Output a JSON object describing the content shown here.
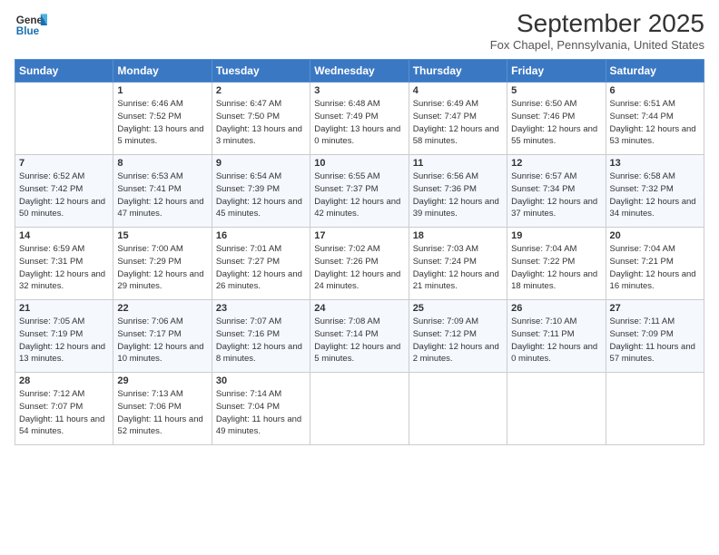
{
  "header": {
    "logo_line1": "General",
    "logo_line2": "Blue",
    "title": "September 2025",
    "subtitle": "Fox Chapel, Pennsylvania, United States"
  },
  "columns": [
    "Sunday",
    "Monday",
    "Tuesday",
    "Wednesday",
    "Thursday",
    "Friday",
    "Saturday"
  ],
  "weeks": [
    [
      {
        "day": "",
        "sunrise": "",
        "sunset": "",
        "daylight": ""
      },
      {
        "day": "1",
        "sunrise": "6:46 AM",
        "sunset": "7:52 PM",
        "daylight": "13 hours and 5 minutes."
      },
      {
        "day": "2",
        "sunrise": "6:47 AM",
        "sunset": "7:50 PM",
        "daylight": "13 hours and 3 minutes."
      },
      {
        "day": "3",
        "sunrise": "6:48 AM",
        "sunset": "7:49 PM",
        "daylight": "13 hours and 0 minutes."
      },
      {
        "day": "4",
        "sunrise": "6:49 AM",
        "sunset": "7:47 PM",
        "daylight": "12 hours and 58 minutes."
      },
      {
        "day": "5",
        "sunrise": "6:50 AM",
        "sunset": "7:46 PM",
        "daylight": "12 hours and 55 minutes."
      },
      {
        "day": "6",
        "sunrise": "6:51 AM",
        "sunset": "7:44 PM",
        "daylight": "12 hours and 53 minutes."
      }
    ],
    [
      {
        "day": "7",
        "sunrise": "6:52 AM",
        "sunset": "7:42 PM",
        "daylight": "12 hours and 50 minutes."
      },
      {
        "day": "8",
        "sunrise": "6:53 AM",
        "sunset": "7:41 PM",
        "daylight": "12 hours and 47 minutes."
      },
      {
        "day": "9",
        "sunrise": "6:54 AM",
        "sunset": "7:39 PM",
        "daylight": "12 hours and 45 minutes."
      },
      {
        "day": "10",
        "sunrise": "6:55 AM",
        "sunset": "7:37 PM",
        "daylight": "12 hours and 42 minutes."
      },
      {
        "day": "11",
        "sunrise": "6:56 AM",
        "sunset": "7:36 PM",
        "daylight": "12 hours and 39 minutes."
      },
      {
        "day": "12",
        "sunrise": "6:57 AM",
        "sunset": "7:34 PM",
        "daylight": "12 hours and 37 minutes."
      },
      {
        "day": "13",
        "sunrise": "6:58 AM",
        "sunset": "7:32 PM",
        "daylight": "12 hours and 34 minutes."
      }
    ],
    [
      {
        "day": "14",
        "sunrise": "6:59 AM",
        "sunset": "7:31 PM",
        "daylight": "12 hours and 32 minutes."
      },
      {
        "day": "15",
        "sunrise": "7:00 AM",
        "sunset": "7:29 PM",
        "daylight": "12 hours and 29 minutes."
      },
      {
        "day": "16",
        "sunrise": "7:01 AM",
        "sunset": "7:27 PM",
        "daylight": "12 hours and 26 minutes."
      },
      {
        "day": "17",
        "sunrise": "7:02 AM",
        "sunset": "7:26 PM",
        "daylight": "12 hours and 24 minutes."
      },
      {
        "day": "18",
        "sunrise": "7:03 AM",
        "sunset": "7:24 PM",
        "daylight": "12 hours and 21 minutes."
      },
      {
        "day": "19",
        "sunrise": "7:04 AM",
        "sunset": "7:22 PM",
        "daylight": "12 hours and 18 minutes."
      },
      {
        "day": "20",
        "sunrise": "7:04 AM",
        "sunset": "7:21 PM",
        "daylight": "12 hours and 16 minutes."
      }
    ],
    [
      {
        "day": "21",
        "sunrise": "7:05 AM",
        "sunset": "7:19 PM",
        "daylight": "12 hours and 13 minutes."
      },
      {
        "day": "22",
        "sunrise": "7:06 AM",
        "sunset": "7:17 PM",
        "daylight": "12 hours and 10 minutes."
      },
      {
        "day": "23",
        "sunrise": "7:07 AM",
        "sunset": "7:16 PM",
        "daylight": "12 hours and 8 minutes."
      },
      {
        "day": "24",
        "sunrise": "7:08 AM",
        "sunset": "7:14 PM",
        "daylight": "12 hours and 5 minutes."
      },
      {
        "day": "25",
        "sunrise": "7:09 AM",
        "sunset": "7:12 PM",
        "daylight": "12 hours and 2 minutes."
      },
      {
        "day": "26",
        "sunrise": "7:10 AM",
        "sunset": "7:11 PM",
        "daylight": "12 hours and 0 minutes."
      },
      {
        "day": "27",
        "sunrise": "7:11 AM",
        "sunset": "7:09 PM",
        "daylight": "11 hours and 57 minutes."
      }
    ],
    [
      {
        "day": "28",
        "sunrise": "7:12 AM",
        "sunset": "7:07 PM",
        "daylight": "11 hours and 54 minutes."
      },
      {
        "day": "29",
        "sunrise": "7:13 AM",
        "sunset": "7:06 PM",
        "daylight": "11 hours and 52 minutes."
      },
      {
        "day": "30",
        "sunrise": "7:14 AM",
        "sunset": "7:04 PM",
        "daylight": "11 hours and 49 minutes."
      },
      {
        "day": "",
        "sunrise": "",
        "sunset": "",
        "daylight": ""
      },
      {
        "day": "",
        "sunrise": "",
        "sunset": "",
        "daylight": ""
      },
      {
        "day": "",
        "sunrise": "",
        "sunset": "",
        "daylight": ""
      },
      {
        "day": "",
        "sunrise": "",
        "sunset": "",
        "daylight": ""
      }
    ]
  ],
  "labels": {
    "sunrise_prefix": "Sunrise: ",
    "sunset_prefix": "Sunset: ",
    "daylight_prefix": "Daylight: "
  }
}
